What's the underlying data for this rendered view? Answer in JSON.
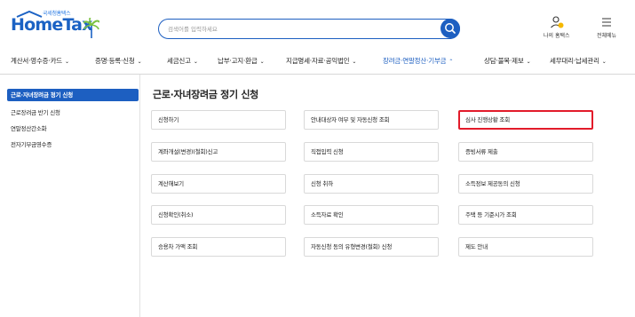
{
  "header": {
    "logo_small": "국세청홈택스",
    "logo_main": "HomeTax",
    "search_placeholder": "검색어를 입력하세요",
    "my_hometax_label": "나의 홈택스",
    "all_menu_label": "전체메뉴"
  },
  "nav": {
    "items": [
      {
        "label": "계산서·영수증·카드"
      },
      {
        "label": "증명·등록·신청"
      },
      {
        "label": "세금신고"
      },
      {
        "label": "납부·고지·환급"
      },
      {
        "label": "지급명세·자료·공익법인"
      },
      {
        "label": "장려금·연말정산·기부금"
      },
      {
        "label": "상담·불복·제보"
      },
      {
        "label": "세무대리·납세관리"
      }
    ],
    "active_index": 5
  },
  "sidebar": {
    "items": [
      {
        "label": "근로·자녀장려금 정기 신청"
      },
      {
        "label": "근로장려금 반기 신청"
      },
      {
        "label": "연말정산간소화"
      },
      {
        "label": "전자기부금영수증"
      }
    ]
  },
  "main": {
    "title": "근로·자녀장려금 정기 신청",
    "cards": [
      {
        "label": "신청하기"
      },
      {
        "label": "안내대상자 여부 및 자동신청 조회"
      },
      {
        "label": "심사 진행상황 조회"
      },
      {
        "label": "계좌개설(변경)(철회)신고"
      },
      {
        "label": "직접입력 신청"
      },
      {
        "label": "증빙서류 제출"
      },
      {
        "label": "계산해보기"
      },
      {
        "label": "신청 취하"
      },
      {
        "label": "소득정보 제공동의 신청"
      },
      {
        "label": "신청확인(취소)"
      },
      {
        "label": "소득자료 확인"
      },
      {
        "label": "주택 등 기준시가 조회"
      },
      {
        "label": "승용차 가액 조회"
      },
      {
        "label": "자동신청 동의 유형변경(철회) 신청"
      },
      {
        "label": "제도 안내"
      }
    ]
  },
  "colors": {
    "brand_blue": "#1d5fc1",
    "highlight_red": "#e21b2a",
    "tree_green": "#7cc242",
    "notify_yellow": "#f5b800"
  }
}
